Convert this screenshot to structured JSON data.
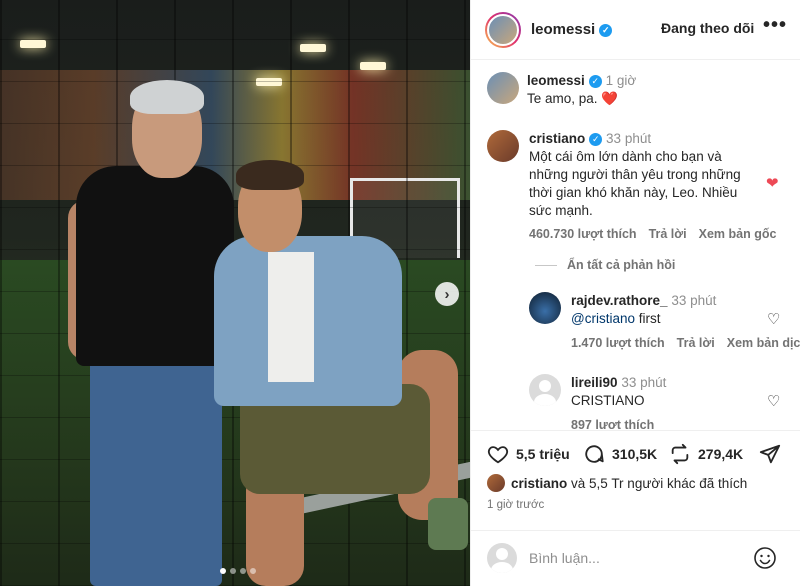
{
  "header": {
    "username": "leomessi",
    "follow_label": "Đang theo dõi",
    "more_label": "•••"
  },
  "caption": {
    "username": "leomessi",
    "time": "1 giờ",
    "text": "Te amo, pa. ❤️"
  },
  "comments": [
    {
      "username": "cristiano",
      "time": "33 phút",
      "text": "Một cái ôm lớn dành cho bạn và những người thân yêu trong những thời gian khó khăn này, Leo. Nhiều sức mạnh.",
      "likes": "460.730 lượt thích",
      "reply": "Trả lời",
      "translate": "Xem bản gốc",
      "liked": true
    }
  ],
  "hide_replies": "Ẩn tất cả phản hồi",
  "replies": [
    {
      "username": "rajdev.rathore_",
      "time": "33 phút",
      "mention": "@cristiano",
      "text": " first",
      "likes": "1.470 lượt thích",
      "reply": "Trả lời",
      "translate": "Xem bản dịch"
    },
    {
      "username": "lireili90",
      "time": "33 phút",
      "text": "CRISTIANO",
      "likes": "897 lượt thích"
    }
  ],
  "actions": {
    "likes": "5,5 triệu",
    "comments": "310,5K",
    "reposts": "279,4K"
  },
  "liked_by": {
    "user": "cristiano",
    "rest": " và 5,5 Tr người khác đã thích"
  },
  "posted": "1 giờ trước",
  "comment_input": {
    "placeholder": "Bình luận..."
  },
  "icons": {
    "next": "chevron-right-icon",
    "like": "heart-icon",
    "comment": "comment-icon",
    "repost": "repost-icon",
    "share": "send-icon",
    "emoji": "emoji-icon"
  },
  "colors": {
    "verified": "#1d9bf0",
    "liked_heart": "#ed4956",
    "mention": "#00376b"
  }
}
